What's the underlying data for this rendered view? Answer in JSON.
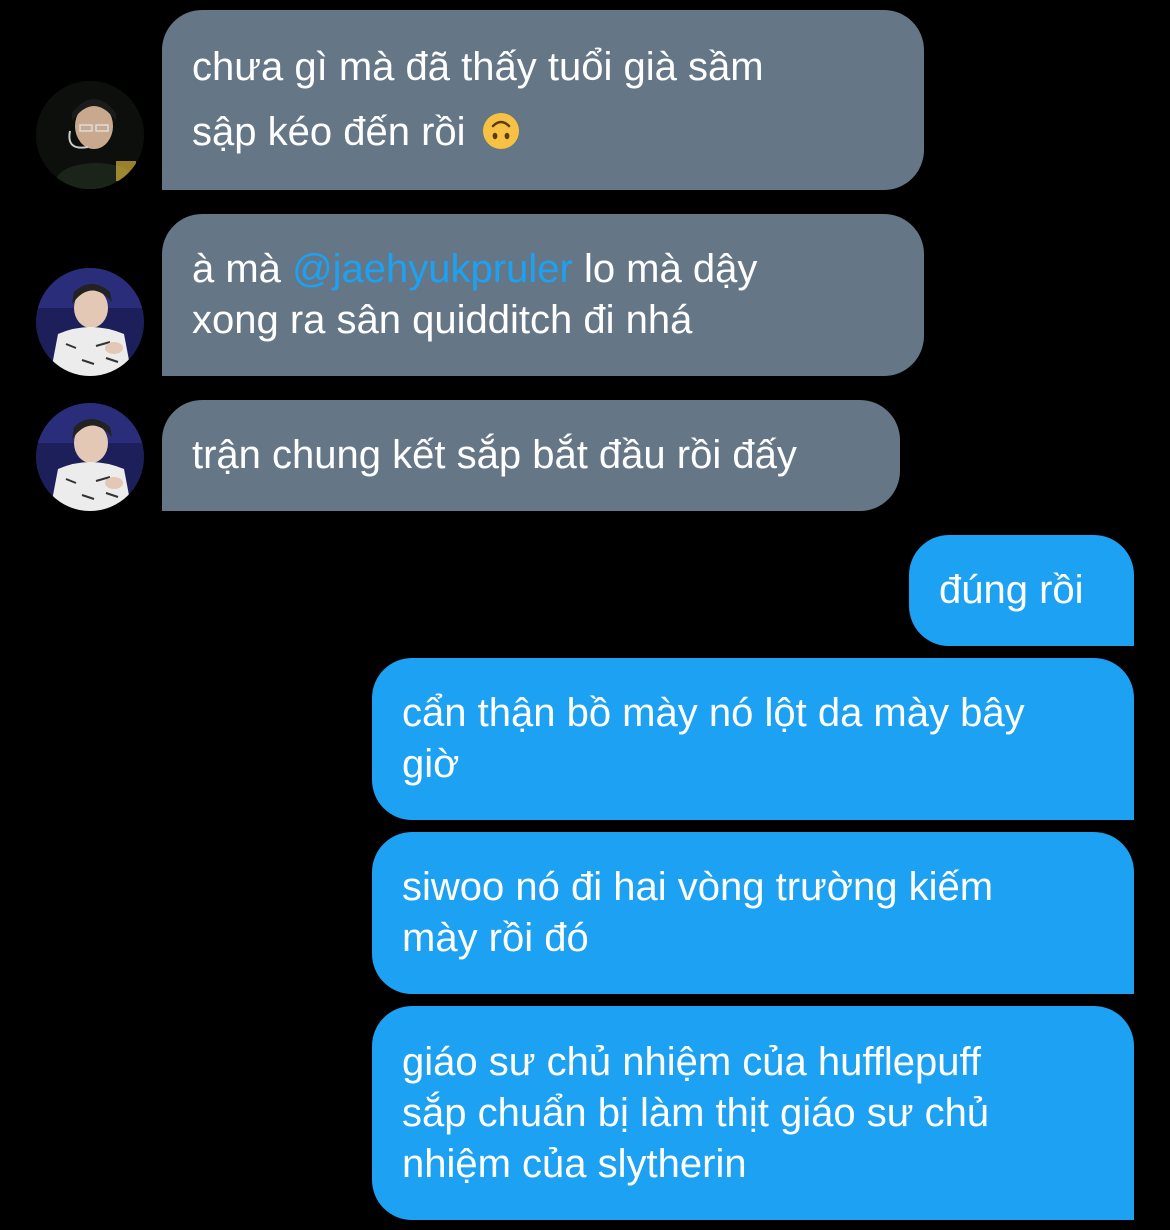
{
  "colors": {
    "background": "#000000",
    "incoming_bubble": "#657786",
    "outgoing_bubble": "#1da1f2",
    "mention": "#1da1f2"
  },
  "messages": [
    {
      "direction": "incoming",
      "avatar": "avatar-1",
      "lines": [
        "chưa gì mà đã thấy tuổi già sầm",
        "sập kéo đến rồi"
      ],
      "emoji": "upside-down-face-icon"
    },
    {
      "direction": "incoming",
      "avatar": "avatar-2",
      "lines": [
        "à mà",
        "@jaehyukpruler",
        "lo mà dậy",
        "xong ra sân quidditch đi nhá"
      ]
    },
    {
      "direction": "incoming",
      "avatar": "avatar-2",
      "lines": [
        "trận chung kết sắp bắt đầu rồi đấy"
      ]
    },
    {
      "direction": "outgoing",
      "lines": [
        "đúng rồi"
      ]
    },
    {
      "direction": "outgoing",
      "lines": [
        "cẩn thận bồ mày nó lột da mày bây",
        "giờ"
      ]
    },
    {
      "direction": "outgoing",
      "lines": [
        "siwoo nó đi hai vòng trường kiếm",
        "mày rồi đó"
      ]
    },
    {
      "direction": "outgoing",
      "lines": [
        "giáo sư chủ nhiệm của hufflepuff",
        "sắp chuẩn bị làm thịt giáo sư chủ",
        "nhiệm của slytherin"
      ]
    }
  ]
}
